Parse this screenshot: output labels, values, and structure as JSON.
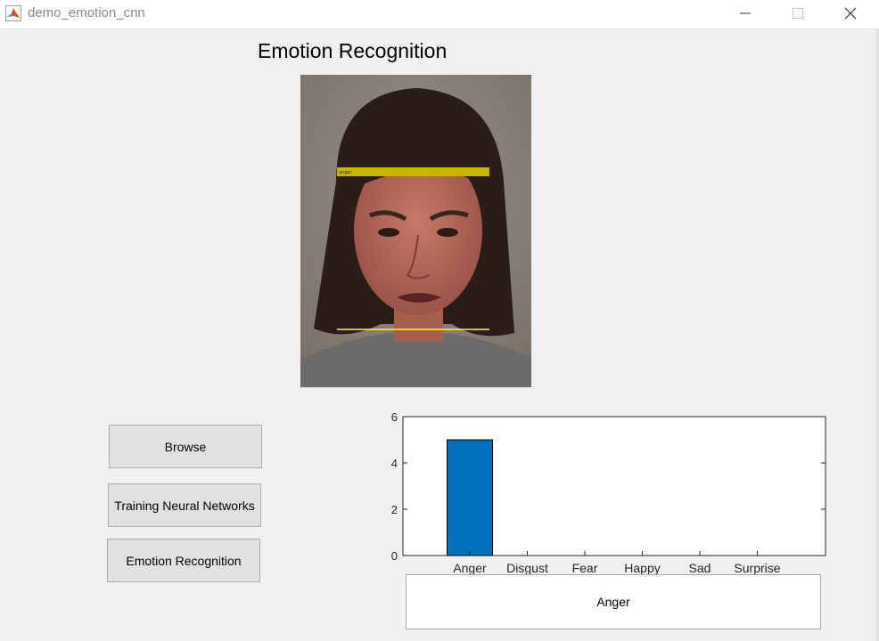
{
  "window": {
    "title": "demo_emotion_cnn",
    "minimize_icon": "minimize-icon",
    "maximize_icon": "maximize-icon",
    "close_icon": "close-icon"
  },
  "figure": {
    "title": "Emotion Recognition"
  },
  "buttons": {
    "browse": "Browse",
    "train": "Training Neural Networks",
    "recognize": "Emotion Recognition"
  },
  "result": {
    "label": "Anger"
  },
  "colors": {
    "bar": "#0072bd",
    "face_box": "#ffff00"
  },
  "chart_data": {
    "type": "bar",
    "categories": [
      "Anger",
      "Disgust",
      "Fear",
      "Happy",
      "Sad",
      "Surprise"
    ],
    "values": [
      5,
      0,
      0,
      0,
      0,
      0
    ],
    "ylim": [
      0,
      6
    ],
    "yticks": [
      0,
      2,
      4,
      6
    ],
    "title": "",
    "xlabel": "",
    "ylabel": ""
  }
}
